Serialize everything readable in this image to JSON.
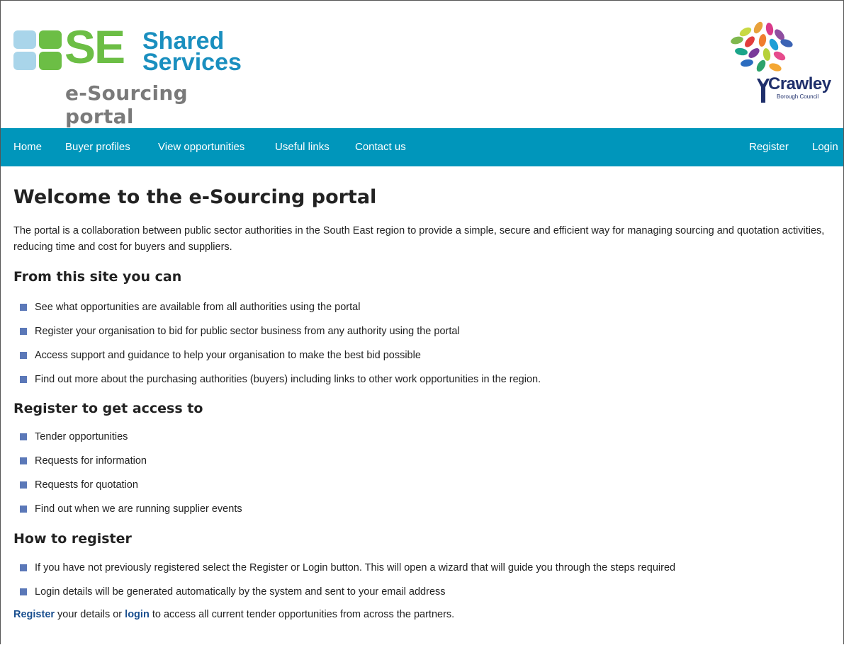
{
  "header": {
    "se_logo": {
      "big_text": "SE",
      "shared_text": "Shared",
      "services_text": "Services",
      "tagline": "e-Sourcing portal",
      "icon_name": "se-squares-logo-icon",
      "colors": {
        "green": "#6cbe45",
        "blue": "#1a8fbf",
        "light_blue": "#a9d5ea",
        "gray": "#7a7a7a"
      }
    },
    "council_logo": {
      "name": "Crawley",
      "subtitle": "Borough Council",
      "icon_name": "tree-leaves-logo-icon"
    }
  },
  "nav": {
    "color": "#0096bb",
    "left_items": [
      "Home",
      "Buyer profiles",
      "View opportunities",
      "Useful links",
      "Contact us"
    ],
    "right_items": [
      "Register",
      "Login"
    ]
  },
  "main": {
    "title": "Welcome to the e-Sourcing portal",
    "intro": "The portal is a collaboration between public sector authorities in the South East region to provide a simple, secure and efficient way for managing sourcing and quotation activities, reducing time and cost for buyers and suppliers.",
    "sections": [
      {
        "heading": "From this site you can",
        "items": [
          "See what opportunities are available from all authorities using the portal",
          "Register your organisation to bid for public sector business from any authority using the portal",
          "Access support and guidance to help your organisation to make the best bid possible",
          "Find out more about the purchasing authorities (buyers) including links to other work opportunities in the region."
        ]
      },
      {
        "heading": "Register to get access to",
        "items": [
          "Tender opportunities",
          "Requests for information",
          "Requests for quotation",
          "Find out when we are running supplier events"
        ]
      },
      {
        "heading": "How to register",
        "items": [
          "If you have not previously registered select the Register or Login button. This will open a wizard that will guide you through the steps required",
          "Login details will be generated automatically by the system and sent to your email address"
        ]
      }
    ],
    "footer": {
      "register_link": "Register",
      "middle_text": " your details or ",
      "login_link": "login",
      "end_text": " to access all current tender opportunities from across the partners."
    }
  }
}
